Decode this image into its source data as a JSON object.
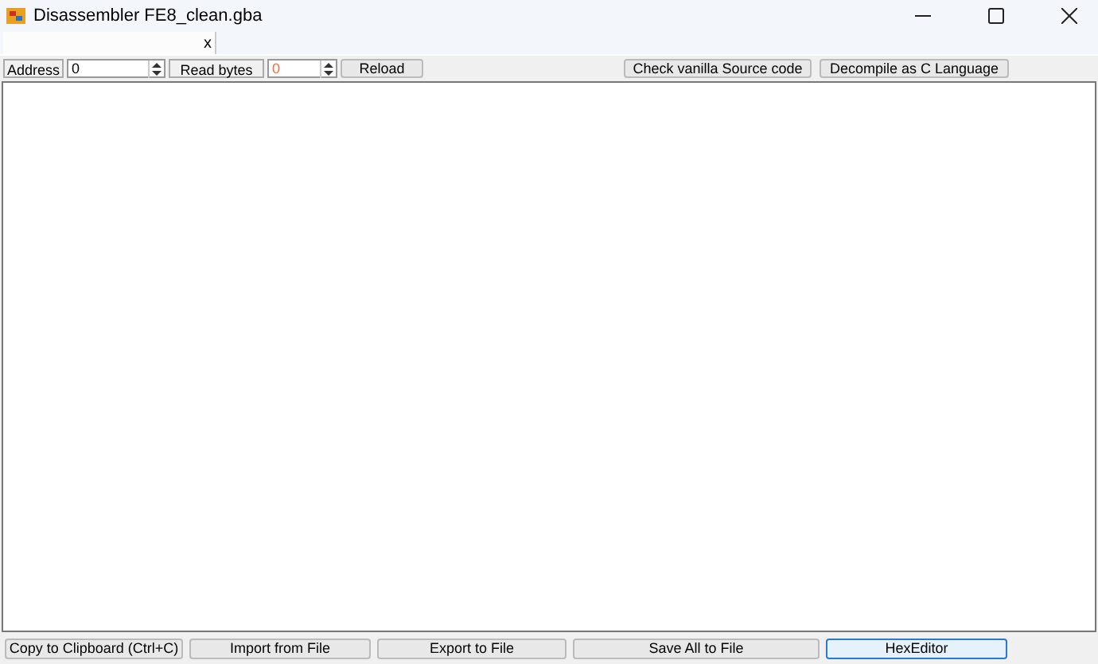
{
  "window": {
    "title": "Disassembler FE8_clean.gba"
  },
  "tabs": [
    {
      "label": "x",
      "selected": true
    }
  ],
  "toolbar": {
    "address_label": "Address",
    "address_value": "0",
    "read_bytes_label": "Read bytes",
    "read_bytes_value": "0",
    "reload": "Reload",
    "check_source": "Check vanilla Source code",
    "decompile": "Decompile as C Language"
  },
  "bottom_buttons": [
    {
      "label": "Copy to Clipboard (Ctrl+C)",
      "focused": false
    },
    {
      "label": "Import from File",
      "focused": false
    },
    {
      "label": "Export to File",
      "focused": false
    },
    {
      "label": "Save All to File",
      "focused": false
    },
    {
      "label": "HexEditor",
      "focused": true
    }
  ]
}
